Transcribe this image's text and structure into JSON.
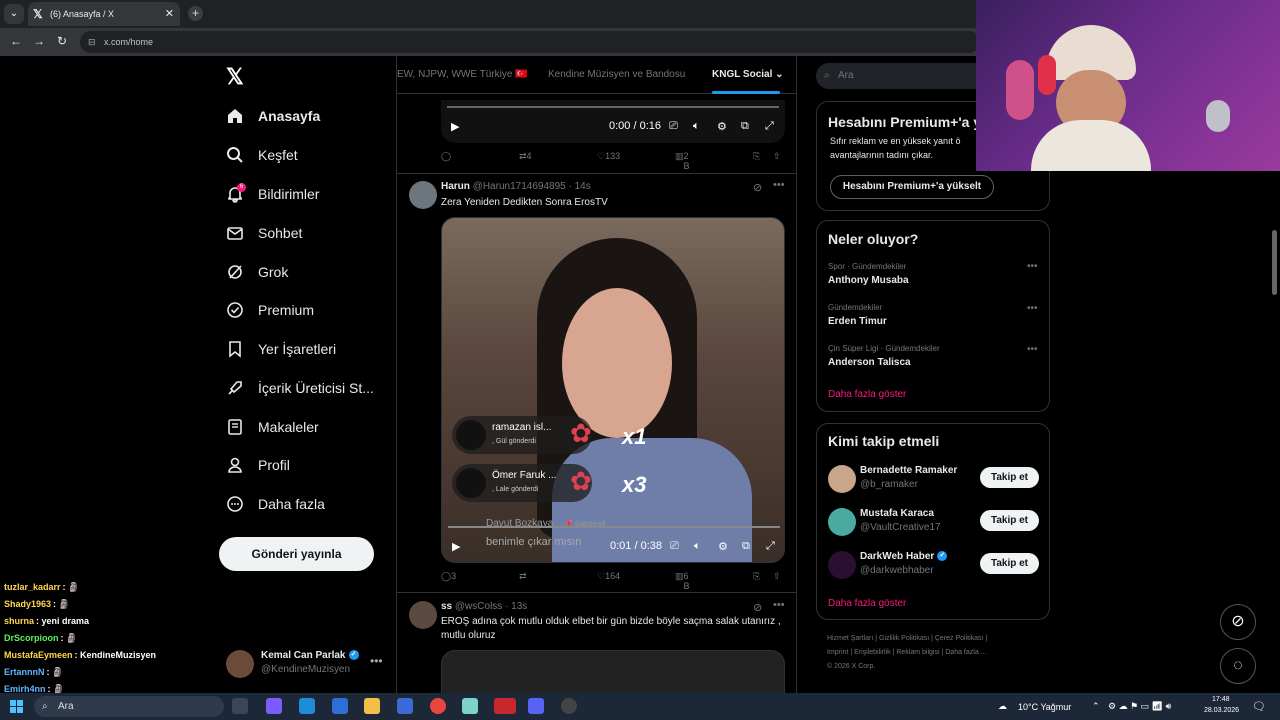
{
  "browser": {
    "tab_title": "(6) Anasayfa / X",
    "url": "x.com/home",
    "menu_icon": "chevron-down",
    "new_tab_icon": "plus"
  },
  "sidebar": {
    "items": [
      {
        "label": "Anasayfa",
        "icon": "home-icon"
      },
      {
        "label": "Keşfet",
        "icon": "search-icon"
      },
      {
        "label": "Bildirimler",
        "icon": "bell-icon",
        "badge": "6"
      },
      {
        "label": "Sohbet",
        "icon": "mail-icon"
      },
      {
        "label": "Grok",
        "icon": "grok-icon"
      },
      {
        "label": "Premium",
        "icon": "premium-icon"
      },
      {
        "label": "Yer İşaretleri",
        "icon": "bookmark-icon"
      },
      {
        "label": "İçerik Üreticisi St...",
        "icon": "rocket-icon"
      },
      {
        "label": "Makaleler",
        "icon": "article-icon"
      },
      {
        "label": "Profil",
        "icon": "person-icon"
      },
      {
        "label": "Daha fazla",
        "icon": "more-circle-icon"
      }
    ],
    "post_button": "Gönderi yayınla",
    "account": {
      "name": "Kemal Can Parlak",
      "handle": "@KendineMuzisyen"
    }
  },
  "feed": {
    "tabs": [
      "EW, NJPW, WWE Türkiye 🇹🇷",
      "Kendine Müzisyen ve Bandosu",
      "KNGL Social"
    ],
    "video1": {
      "time": "0:00 / 0:16",
      "retweets": "4",
      "likes": "133",
      "views": "2 B"
    },
    "tweet2": {
      "name": "Harun",
      "handle": "@Harun1714694895",
      "time": "· 14s",
      "text": "Zera Yeniden Dedikten Sonra ErosTV",
      "gifts": [
        {
          "name": "ramazan isl...",
          "sub": ", Gül gönderdi",
          "count": "x1"
        },
        {
          "name": "Ömer Faruk ...",
          "sub": ", Lale gönderdi",
          "count": "x3"
        }
      ],
      "overlay_user": "Davut Bozkaya",
      "overlay_pin": "📌 Sabitlendi",
      "overlay_msg": "benimle çıkar mısın",
      "time_code": "0:01 / 0:38",
      "replies": "3",
      "likes": "164",
      "views": "6 B"
    },
    "tweet3": {
      "name": "ss",
      "handle": "@wsColss",
      "time": "· 13s",
      "text": "EROŞ adına çok mutlu olduk elbet bir gün bizde böyle saçma salak utanırız , mutlu oluruz"
    }
  },
  "right": {
    "search_placeholder": "Ara",
    "premium": {
      "title": "Hesabını Premium+'a y",
      "desc1": "Sıfır reklam ve en yüksek yanıt ö",
      "desc2": "avantajlarının tadını çıkar.",
      "button": "Hesabını Premium+'a yükselt"
    },
    "trends": {
      "title": "Neler oluyor?",
      "items": [
        {
          "meta": "Spor · Gündemdekiler",
          "name": "Anthony Musaba"
        },
        {
          "meta": "Gündemdekiler",
          "name": "Erden Timur"
        },
        {
          "meta": "Çin Süper Ligi · Gündemdekiler",
          "name": "Anderson Talisca"
        }
      ],
      "more": "Daha fazla göster"
    },
    "who": {
      "title": "Kimi takip etmeli",
      "items": [
        {
          "name": "Bernadette Ramaker",
          "handle": "@b_ramaker",
          "button": "Takip et"
        },
        {
          "name": "Mustafa Karaca",
          "handle": "@VaultCreative17",
          "button": "Takip et"
        },
        {
          "name": "DarkWeb Haber",
          "handle": "@darkwebhaber",
          "button": "Takip et",
          "verified": true
        }
      ],
      "more": "Daha fazla göster"
    },
    "footer": {
      "line1": "Hizmet Şartları  |  Gizlilik Politikası  |  Çerez Politikası  |",
      "line2": "Imprint  |  Erişilebilirlik  |  Reklam bilgisi  |  Daha fazla ...",
      "line3": "© 2026 X Corp."
    }
  },
  "chat": [
    {
      "user": "tuzlar_kadarr",
      "msg": "",
      "color": "#ffd84d"
    },
    {
      "user": "Shady1963",
      "msg": "",
      "color": "#ffd84d"
    },
    {
      "user": "shurna",
      "msg": "yeni drama",
      "color": "#ffd84d"
    },
    {
      "user": "DrScorpioon",
      "msg": "",
      "color": "#5cf25c"
    },
    {
      "user": "MustafaEymeen",
      "msg": "KendineMuzisyen",
      "color": "#ffd84d"
    },
    {
      "user": "ErtannnN",
      "msg": "",
      "color": "#5cb8ff"
    },
    {
      "user": "Emirh4nn",
      "msg": "",
      "color": "#5cb8ff"
    }
  ],
  "taskbar": {
    "search": "Ara",
    "weather": "10°C  Yağmur",
    "time": "17:48",
    "date": "28.03.2026"
  },
  "colors": {
    "accent": "#1d9bf0",
    "pink": "#f91880",
    "bg": "#000000"
  }
}
